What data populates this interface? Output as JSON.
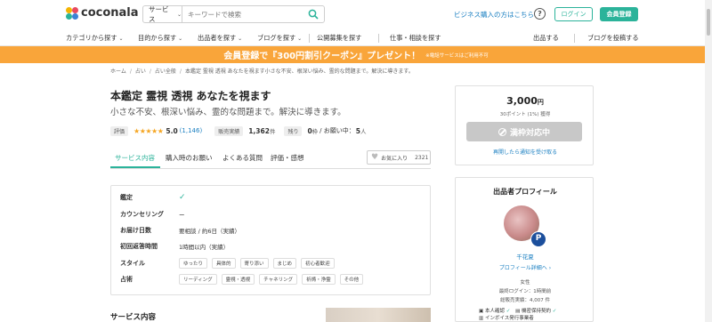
{
  "header": {
    "logo": "coconala",
    "search_category": "サービス",
    "search_placeholder": "キーワードで検索",
    "business_link": "ビジネス購入の方はこちら",
    "help": "?",
    "login": "ログイン",
    "signup": "会員登録"
  },
  "nav": {
    "items": [
      "カテゴリから探す",
      "目的から探す",
      "出品者を探す",
      "ブログを探す",
      "公開募集を探す",
      "仕事・相談を探す"
    ],
    "right": [
      "出品する",
      "ブログを投稿する"
    ]
  },
  "banner": {
    "main": "会員登録で『300円割引クーポン』プレゼント！",
    "note": "※電話サービスはご利用不可"
  },
  "breadcrumb": [
    "ホーム",
    "占い",
    "占い全般",
    "本鑑定 霊視 透視 あなたを視ます小さな不安、根深い悩み、霊的な問題まで。解決に導きます。"
  ],
  "service": {
    "title": "本鑑定 霊視 透視 あなたを視ます",
    "subtitle": "小さな不安、根深い悩み、霊的な問題まで。解決に導きます。",
    "rating_label": "評価",
    "stars": "★★★★★",
    "rating": "5.0",
    "rating_count": "(1,146)",
    "sales_label": "販売実績",
    "sales": "1,362",
    "sales_unit": "件",
    "remaining_label": "残り",
    "remaining": "0",
    "remaining_unit": "枠",
    "in_progress_text": "/ お願い中：",
    "in_progress": "5",
    "in_progress_unit": "人"
  },
  "tabs": [
    "サービス内容",
    "購入時のお願い",
    "よくある質問",
    "評価・感想"
  ],
  "favorite": {
    "label": "お気に入り",
    "count": "2321"
  },
  "info": {
    "rows": [
      {
        "label": "鑑定",
        "value": "✓"
      },
      {
        "label": "カウンセリング",
        "value": "ー"
      },
      {
        "label": "お届け日数",
        "value": "要相談 / 約6日（実績）"
      },
      {
        "label": "初回返答時間",
        "value": "1時間以内（実績）"
      },
      {
        "label": "スタイル",
        "chips": [
          "ゆったり",
          "具体的",
          "寄り添い",
          "まじめ",
          "初心者歓迎"
        ]
      },
      {
        "label": "占術",
        "chips": [
          "リーディング",
          "霊視・透視",
          "チャネリング",
          "祈祷・浄霊",
          "その他"
        ]
      }
    ]
  },
  "section_heading": "サービス内容",
  "price": {
    "amount": "3,000",
    "yen": "円",
    "points": "30ポイント (1%) 獲得",
    "soldout": "満枠対応中",
    "notify": "再開したら通知を受け取る"
  },
  "profile": {
    "heading": "出品者プロフィール",
    "badge": "P",
    "name": "千花夏",
    "detail_link": "プロフィール詳細へ",
    "gender": "女性",
    "last_login": "最終ログイン：1時間前",
    "total_sales": "総販売実績：4,007 件",
    "identity": "本人確認",
    "contract": "機密保持契約",
    "invoice": "インボイス発行事業者"
  }
}
